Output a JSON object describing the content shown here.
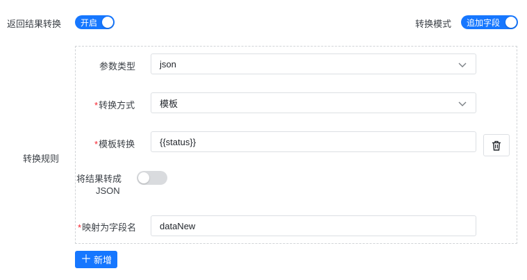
{
  "header": {
    "return_label": "返回结果转换",
    "return_switch": "开启",
    "mode_label": "转换模式",
    "mode_switch": "追加字段"
  },
  "rules": {
    "section_label": "转换规则",
    "param_type_label": "参数类型",
    "param_type_value": "json",
    "method_label": "转换方式",
    "method_value": "模板",
    "template_label": "模板转换",
    "template_value": "{{status}}",
    "to_json_label_line1": "将结果转成",
    "to_json_label_line2": "JSON",
    "to_json_on": false,
    "map_label": "映射为字段名",
    "map_value": "dataNew",
    "required_mark": "*"
  },
  "actions": {
    "add_label": "新增"
  },
  "colors": {
    "primary": "#1677ff",
    "required": "#f5222d",
    "switch_off": "#d9dbde"
  },
  "icons": {
    "select": "chevron-down-icon",
    "delete": "trash-icon",
    "add": "plus-icon"
  }
}
